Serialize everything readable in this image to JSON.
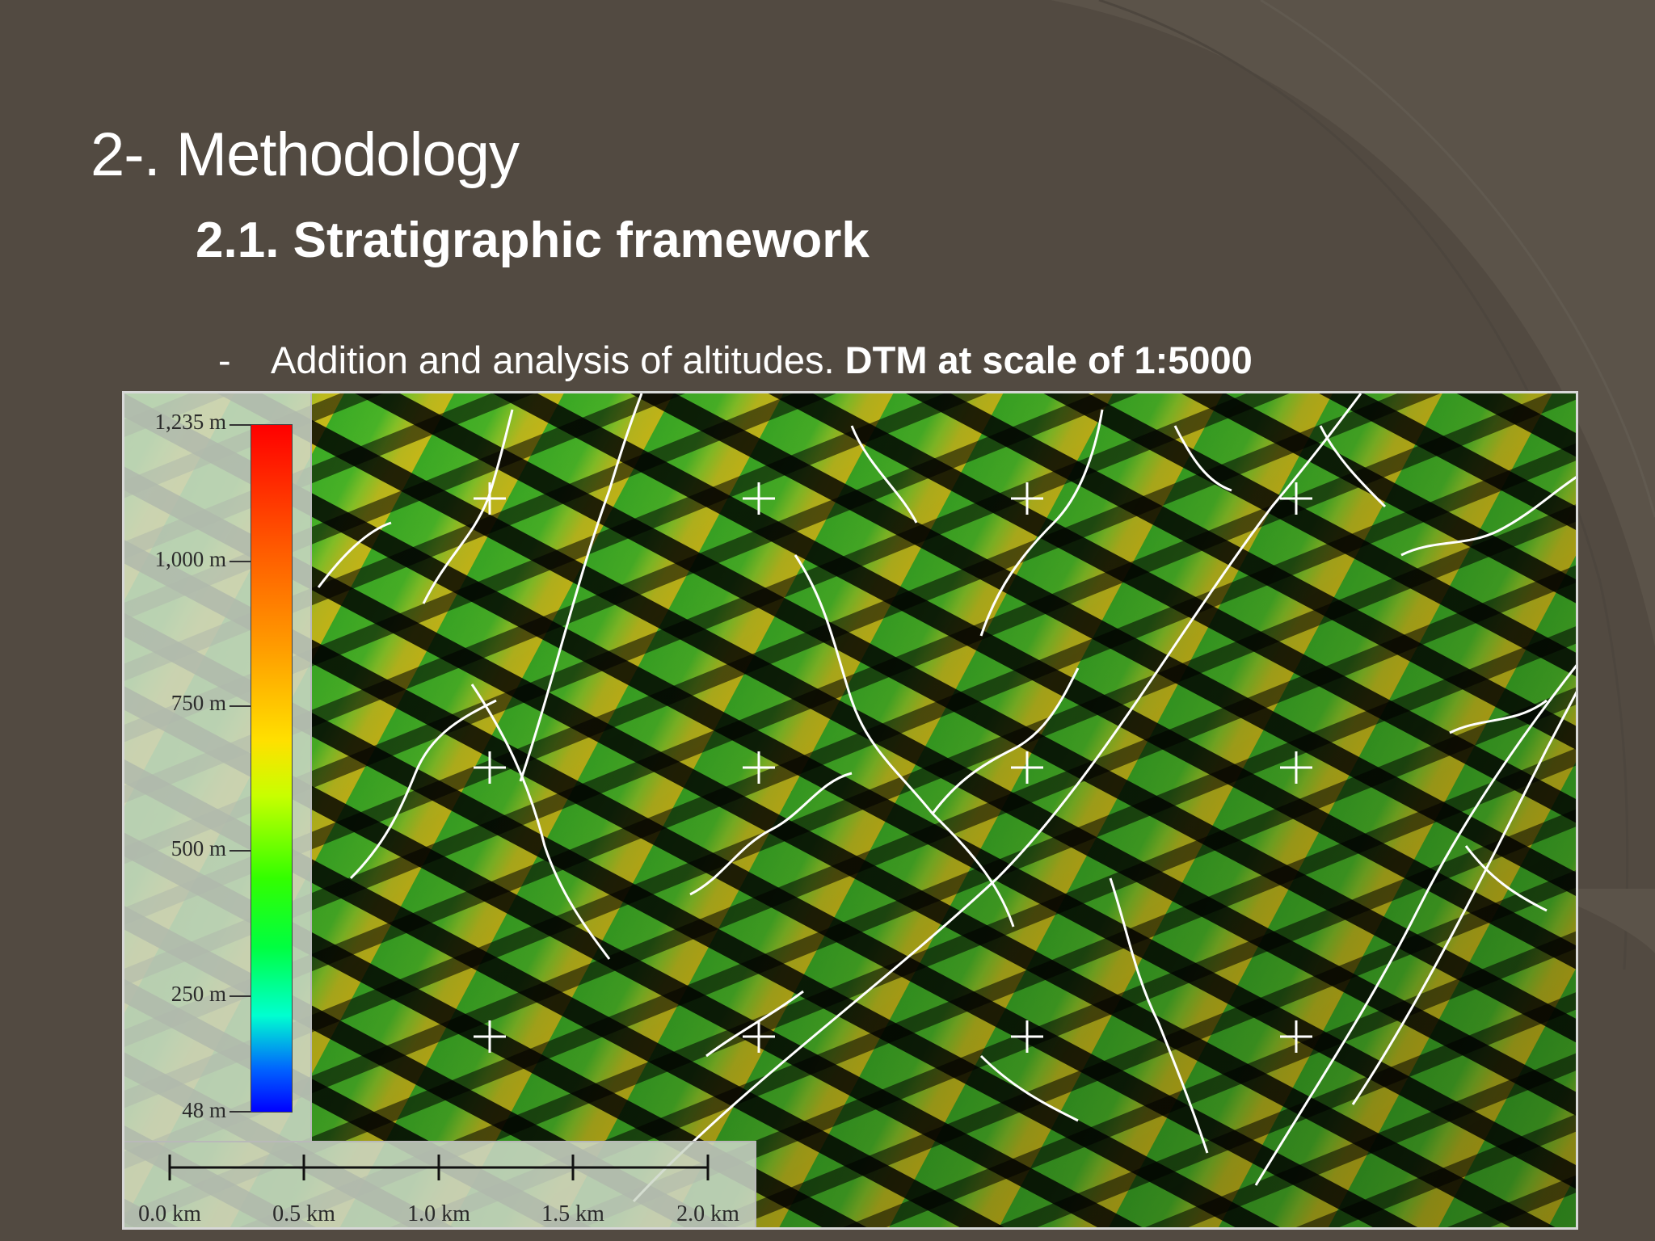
{
  "slide": {
    "title": "2-. Methodology",
    "subtitle": "2.1. Stratigraphic framework",
    "bullet": {
      "marker": "-",
      "text": "Addition and analysis of altitudes. ",
      "emphasis": "DTM at scale of 1:5000"
    }
  },
  "map": {
    "elevation_legend": {
      "labels": [
        "1,235 m",
        "1,000 m",
        "750 m",
        "500 m",
        "250 m",
        "48 m"
      ],
      "colormap": [
        "#ff0000",
        "#ff9a00",
        "#ffe000",
        "#33ff00",
        "#00ffd0",
        "#0000ff"
      ]
    },
    "scale_bar": {
      "labels": [
        "0.0 km",
        "0.5 km",
        "1.0 km",
        "1.5 km",
        "2.0 km"
      ]
    }
  },
  "colors": {
    "background": "#524a41",
    "text": "#ffffff"
  }
}
